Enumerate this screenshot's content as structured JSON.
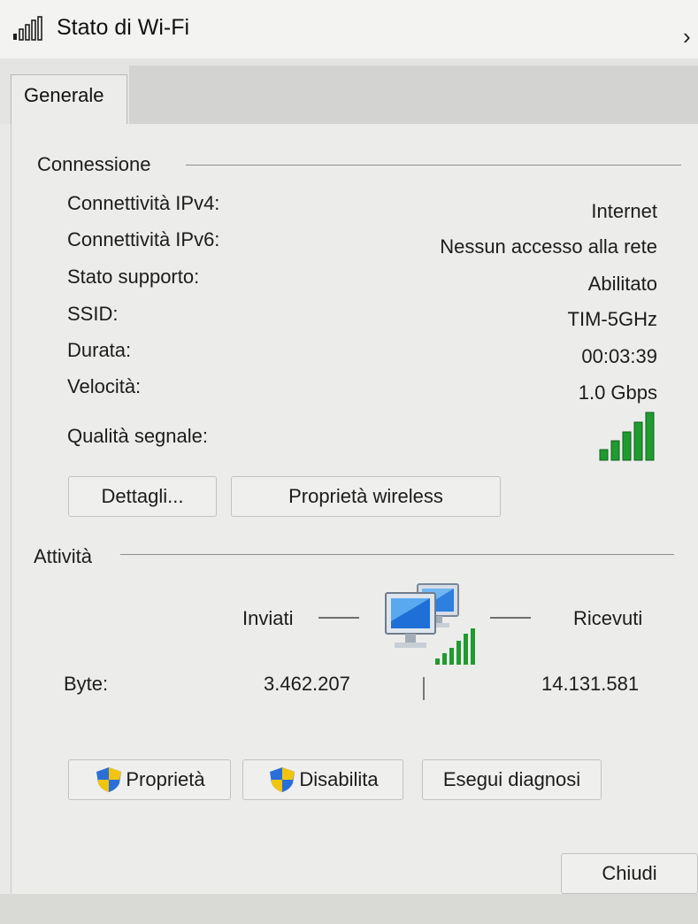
{
  "window": {
    "title": "Stato di Wi-Fi",
    "close_glyph": "›",
    "title_icon": "wifi-signal-icon"
  },
  "tabs": [
    {
      "label": "Generale",
      "selected": true
    }
  ],
  "connection": {
    "heading": "Connessione",
    "rows": [
      {
        "label": "Connettività IPv4:",
        "value": "Internet"
      },
      {
        "label": "Connettività IPv6:",
        "value": "Nessun accesso alla rete"
      },
      {
        "label": "Stato supporto:",
        "value": "Abilitato"
      },
      {
        "label": "SSID:",
        "value": "TIM-5GHz"
      },
      {
        "label": "Durata:",
        "value": "00:03:39"
      },
      {
        "label": "Velocità:",
        "value": "1.0 Gbps"
      }
    ],
    "signal": {
      "label": "Qualità segnale:",
      "bars_total": 5,
      "bars_filled": 5,
      "color": "#1f9b2f"
    }
  },
  "buttons_top": {
    "details": "Dettagli...",
    "wireless_props": "Proprietà wireless"
  },
  "activity": {
    "heading": "Attività",
    "sent_label": "Inviati",
    "received_label": "Ricevuti",
    "bytes_label": "Byte:",
    "bytes_sent": "3.462.207",
    "bytes_received": "14.131.581",
    "icon": "network-computers-icon"
  },
  "buttons_bottom": {
    "properties": "Proprietà",
    "disable": "Disabilita",
    "diagnose": "Esegui diagnosi",
    "close": "Chiudi"
  },
  "colors": {
    "signal_green": "#1f9b2f",
    "uac_blue": "#2a6fd6",
    "uac_yellow": "#f1c40f"
  }
}
